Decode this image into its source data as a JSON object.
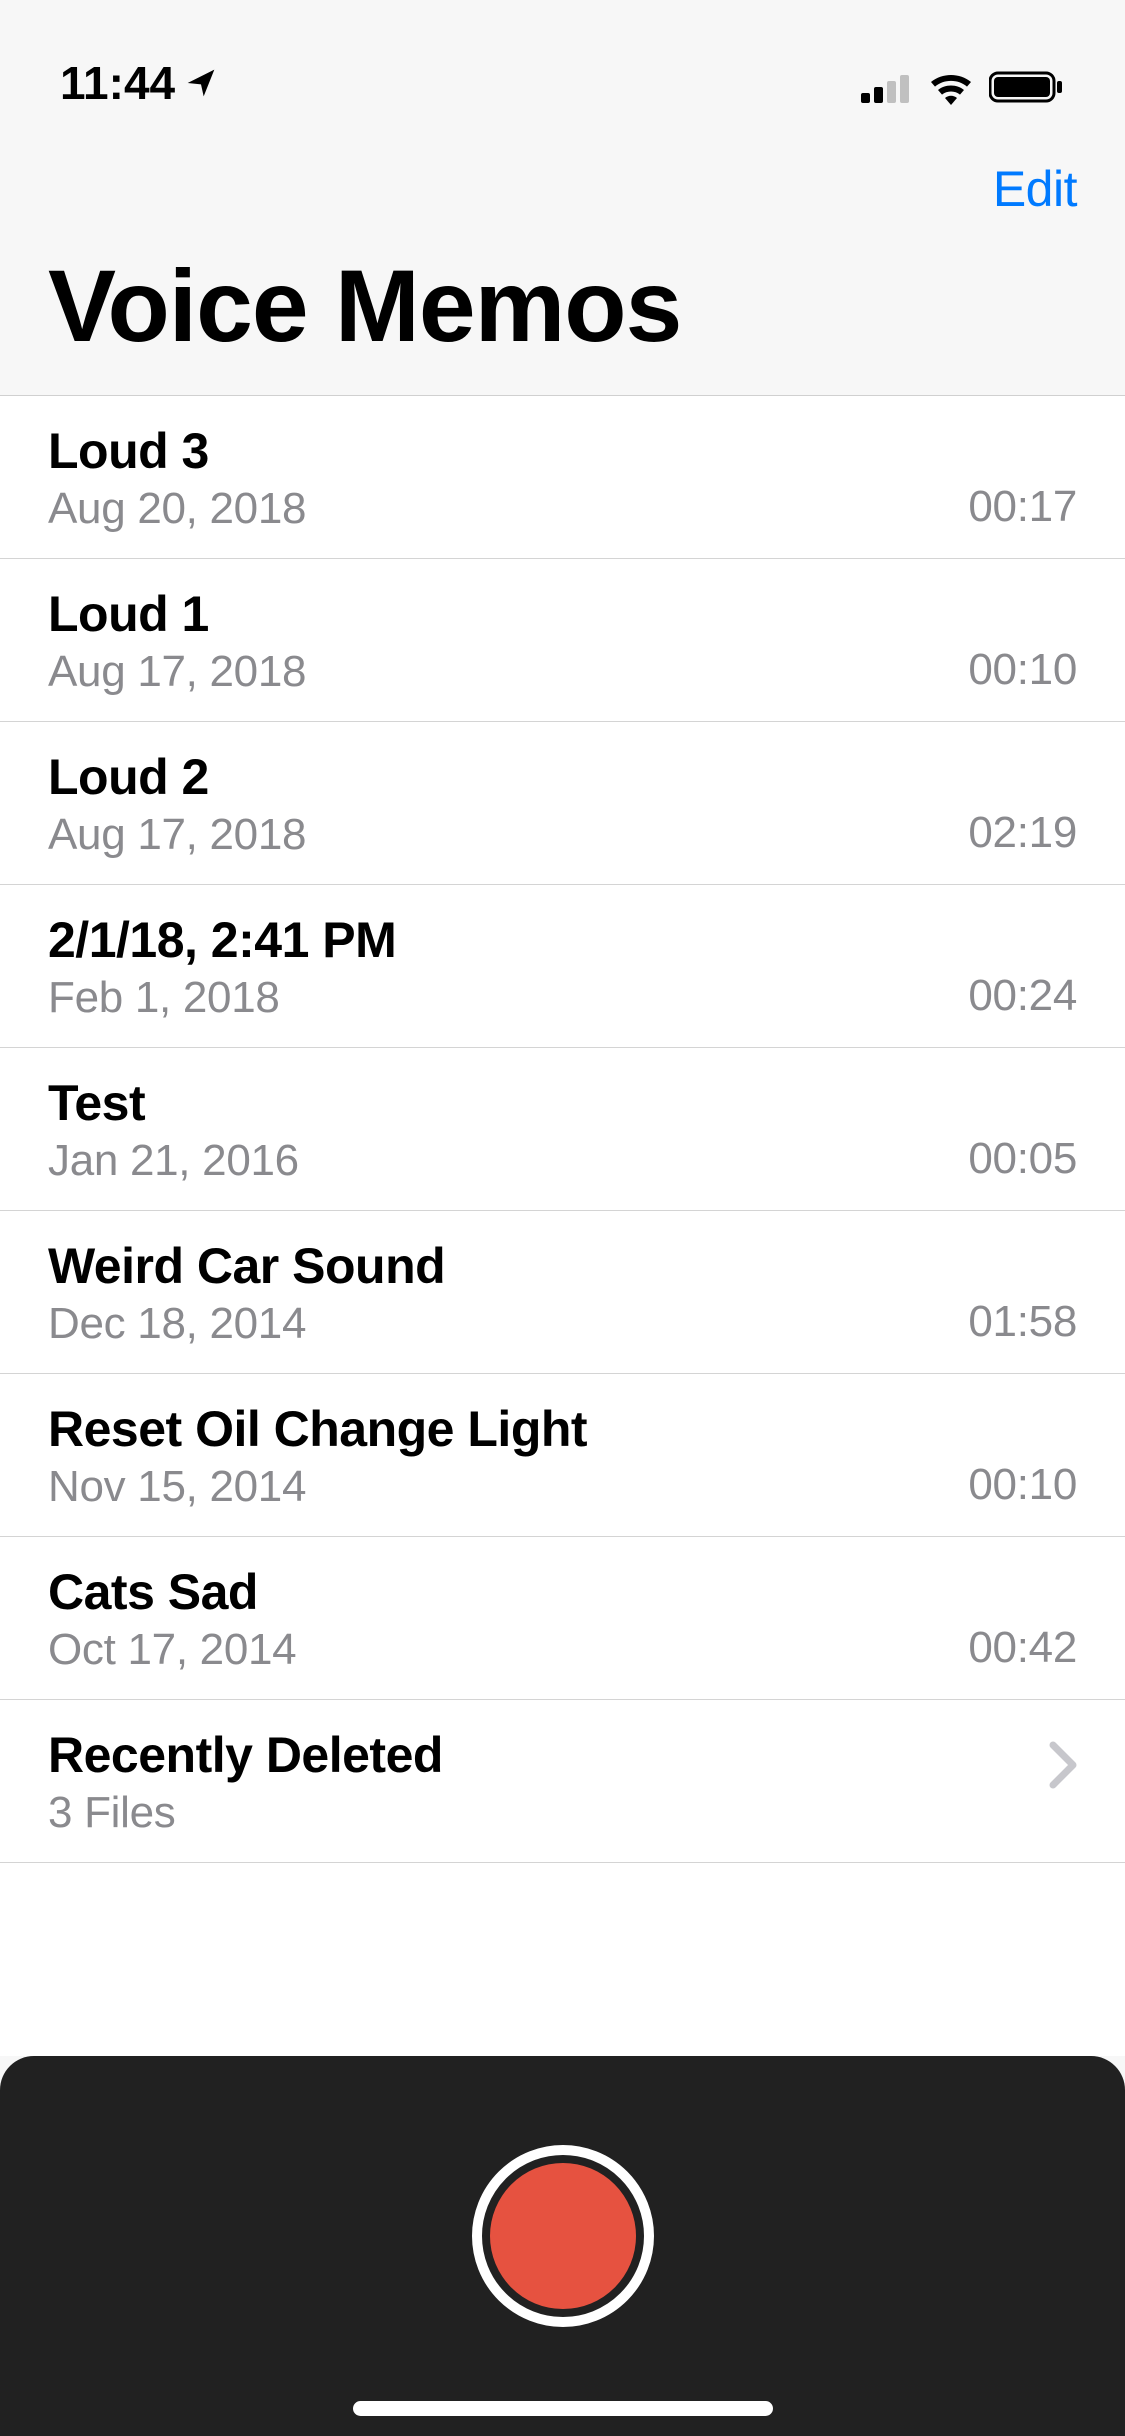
{
  "statusBar": {
    "time": "11:44"
  },
  "nav": {
    "editLabel": "Edit"
  },
  "title": "Voice Memos",
  "memos": [
    {
      "title": "Loud 3",
      "date": "Aug 20, 2018",
      "duration": "00:17"
    },
    {
      "title": "Loud 1",
      "date": "Aug 17, 2018",
      "duration": "00:10"
    },
    {
      "title": "Loud 2",
      "date": "Aug 17, 2018",
      "duration": "02:19"
    },
    {
      "title": "2/1/18, 2:41 PM",
      "date": "Feb 1, 2018",
      "duration": "00:24"
    },
    {
      "title": "Test",
      "date": "Jan 21, 2016",
      "duration": "00:05"
    },
    {
      "title": "Weird Car Sound",
      "date": "Dec 18, 2014",
      "duration": "01:58"
    },
    {
      "title": "Reset Oil Change Light",
      "date": "Nov 15, 2014",
      "duration": "00:10"
    },
    {
      "title": "Cats Sad",
      "date": "Oct 17, 2014",
      "duration": "00:42"
    }
  ],
  "recentlyDeleted": {
    "title": "Recently Deleted",
    "subtitle": "3 Files"
  }
}
